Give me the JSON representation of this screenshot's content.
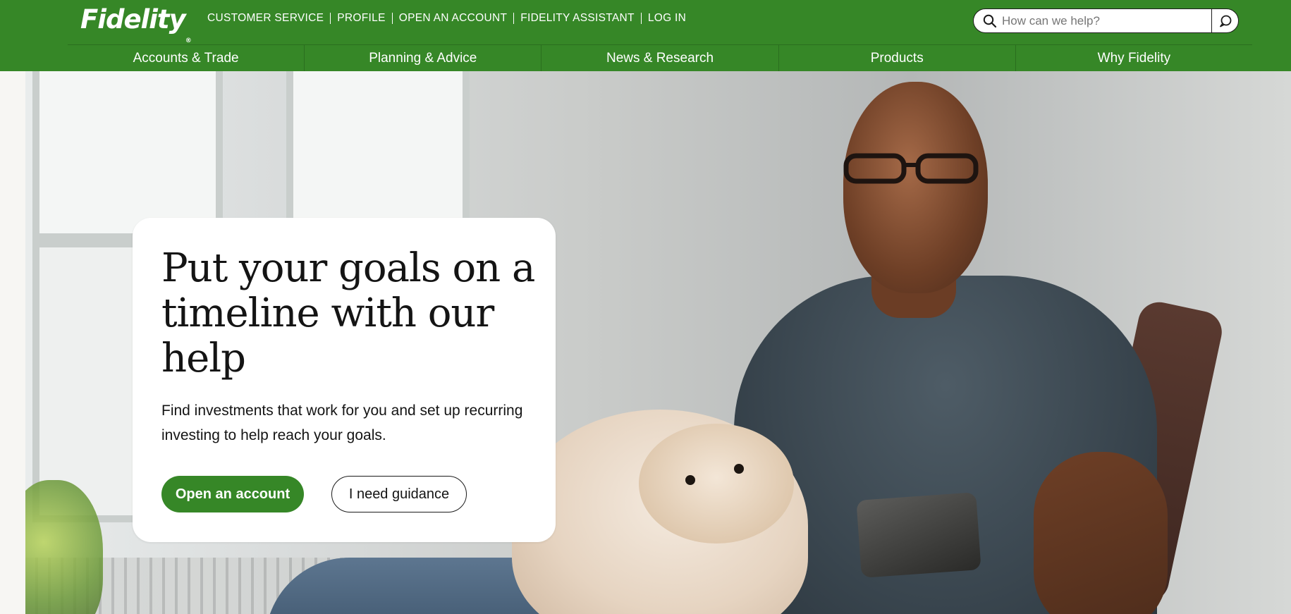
{
  "brand": {
    "name": "Fidelity",
    "mark": "®",
    "color": "#368727"
  },
  "utility_nav": [
    {
      "label": "CUSTOMER SERVICE"
    },
    {
      "label": "PROFILE"
    },
    {
      "label": "OPEN AN ACCOUNT"
    },
    {
      "label": "FIDELITY ASSISTANT"
    },
    {
      "label": "LOG IN"
    }
  ],
  "search": {
    "placeholder": "How can we help?",
    "value": "",
    "icon": "search-icon",
    "submit_icon": "chat-bubble-icon"
  },
  "main_nav": [
    {
      "label": "Accounts & Trade"
    },
    {
      "label": "Planning & Advice"
    },
    {
      "label": "News & Research"
    },
    {
      "label": "Products"
    },
    {
      "label": "Why Fidelity"
    }
  ],
  "hero": {
    "image_description": "man-with-dog-using-phone",
    "headline": "Put your goals on a timeline with our help",
    "body": "Find investments that work for you and set up recurring investing to help reach your goals.",
    "primary_cta": "Open an account",
    "secondary_cta": "I need guidance"
  }
}
